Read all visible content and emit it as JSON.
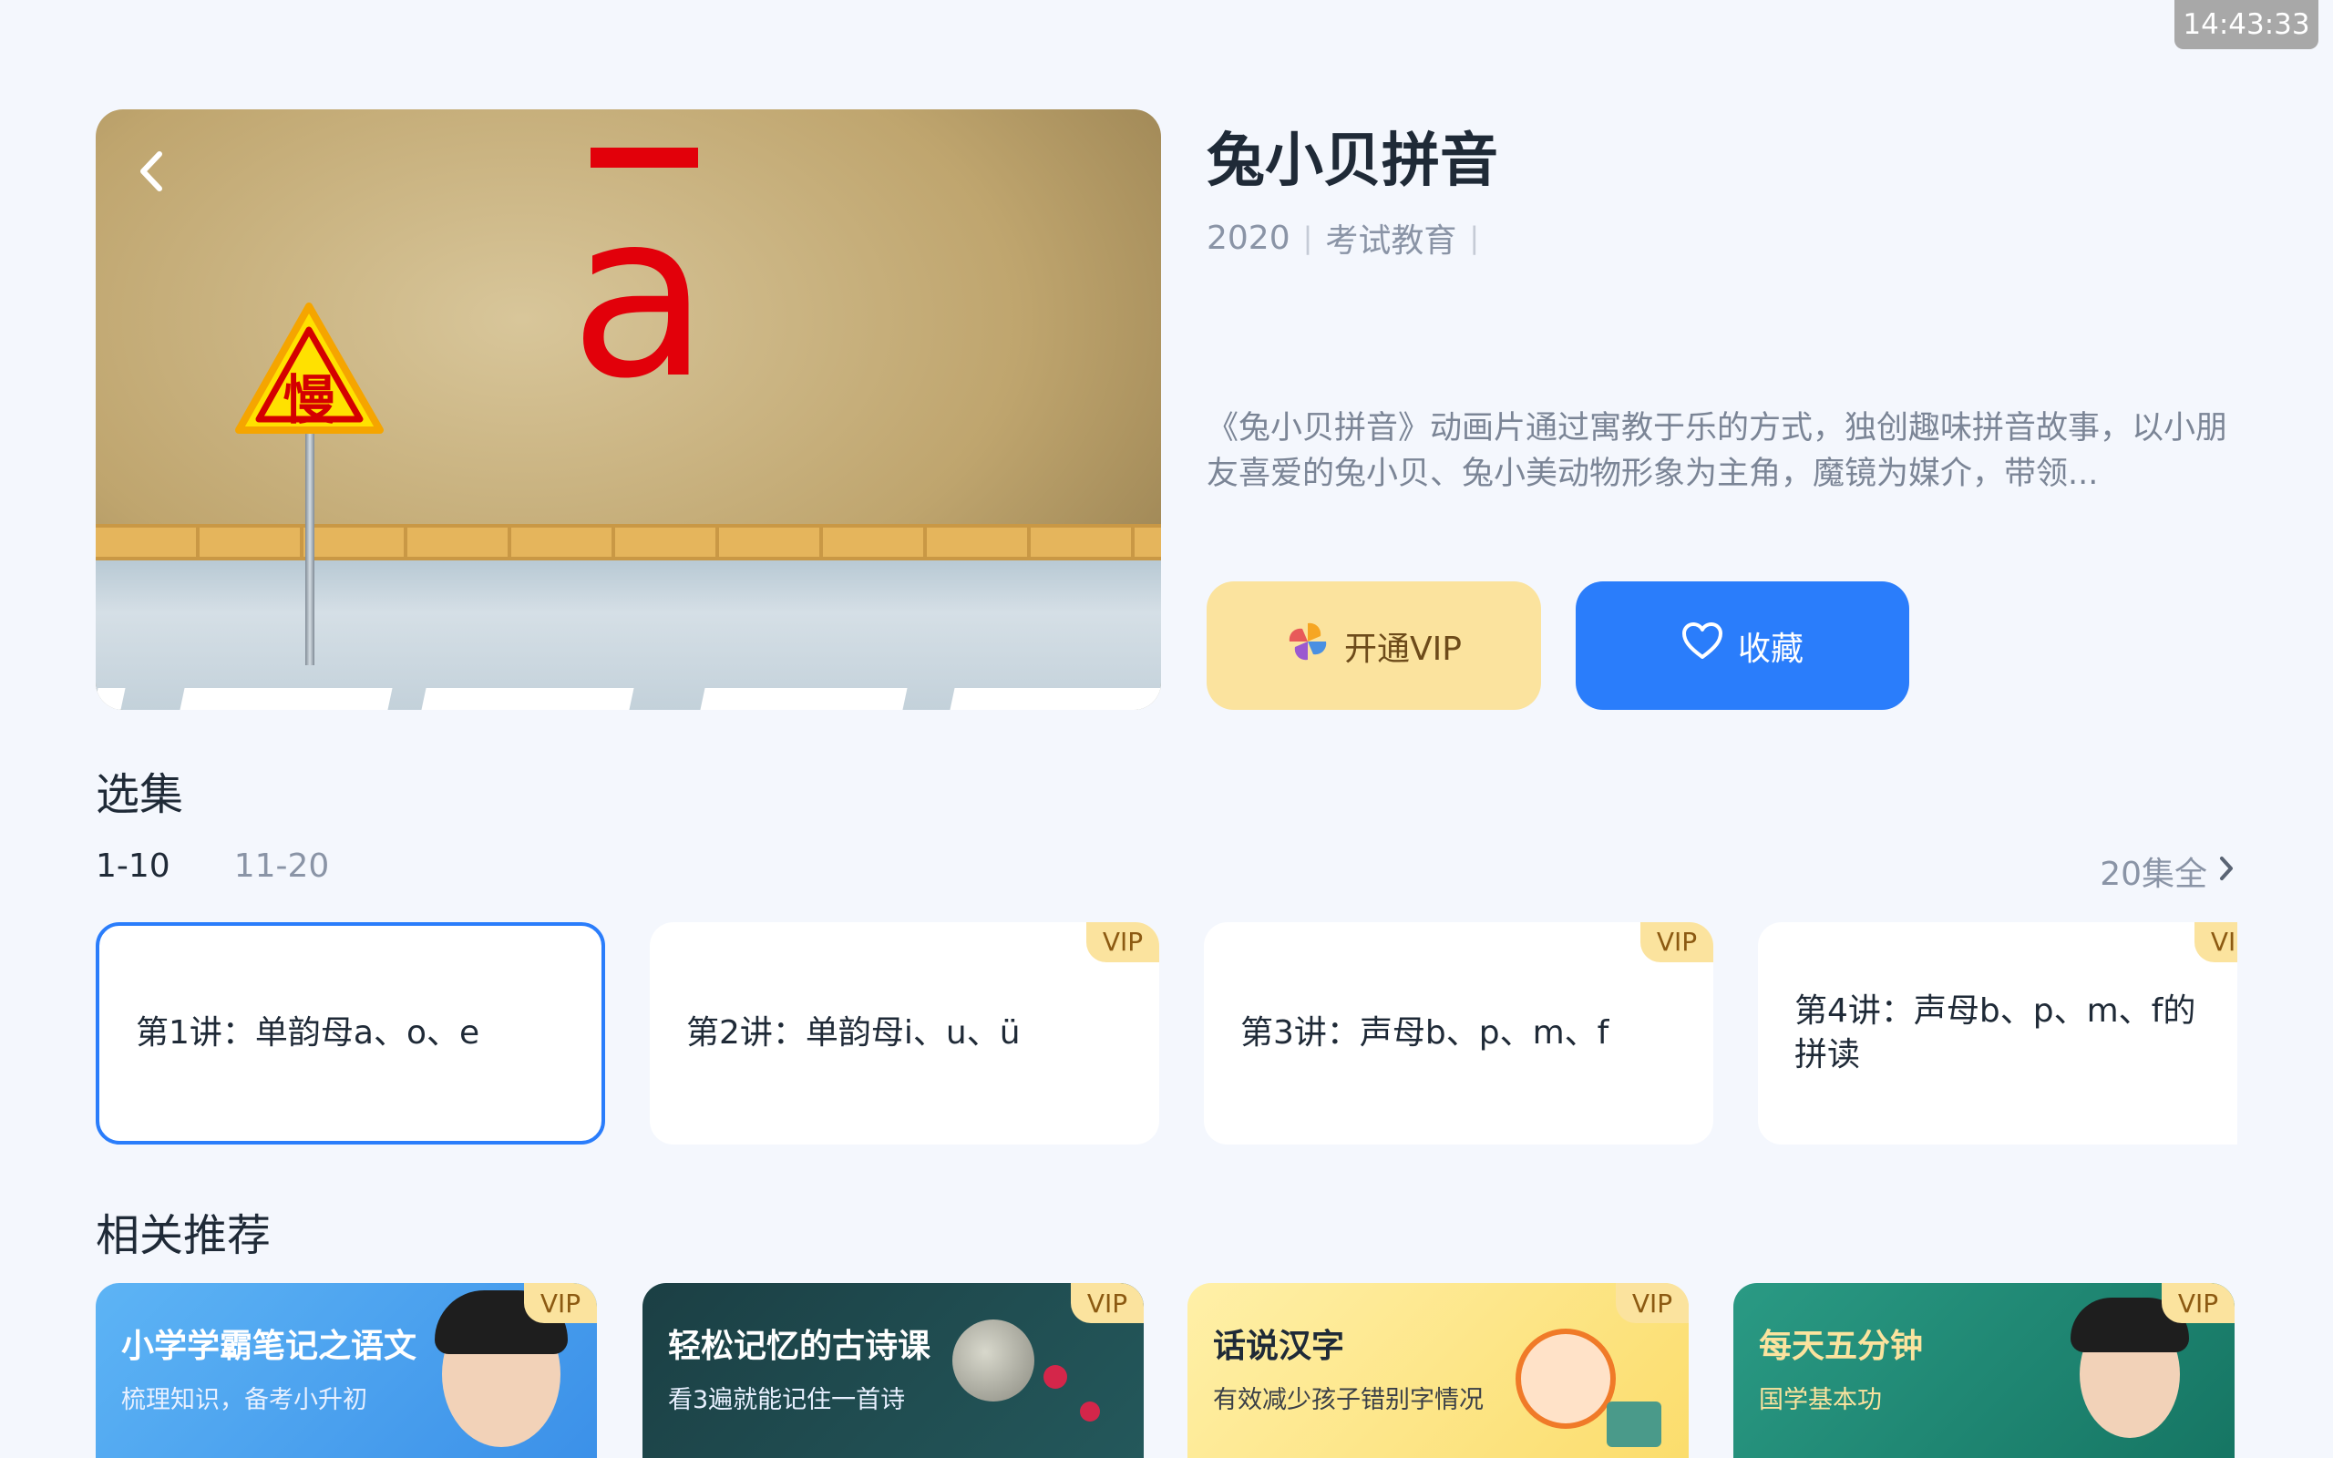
{
  "status_bar": {
    "time": "14:43:33"
  },
  "hero": {
    "sign_char": "慢",
    "pinyin_letter": "a"
  },
  "show": {
    "title": "兔小贝拼音",
    "year": "2020",
    "category": "考试教育",
    "description": "《兔小贝拼音》动画片通过寓教于乐的方式，独创趣味拼音故事，以小朋友喜爱的兔小贝、兔小美动物形象为主角，魔镜为媒介，带领..."
  },
  "actions": {
    "vip_label": "开通VIP",
    "favorite_label": "收藏"
  },
  "episodes_section": {
    "title": "选集",
    "tabs": [
      "1-10",
      "11-20"
    ],
    "total_label": "20集全",
    "items": [
      {
        "label": "第1讲：单韵母a、o、e",
        "vip": false,
        "selected": true
      },
      {
        "label": "第2讲：单韵母i、u、ü",
        "vip": true,
        "vip_label": "VIP"
      },
      {
        "label": "第3讲：声母b、p、m、f",
        "vip": true,
        "vip_label": "VIP"
      },
      {
        "label": "第4讲：声母b、p、m、f的拼读",
        "vip": true,
        "vip_label": "VIP"
      }
    ]
  },
  "recommend_section": {
    "title": "相关推荐",
    "items": [
      {
        "title": "小学学霸笔记之语文",
        "subtitle": "梳理知识，备考小升初",
        "vip_label": "VIP",
        "bg": "#4aa3f0"
      },
      {
        "title": "轻松记忆的古诗课",
        "subtitle": "看3遍就能记住一首诗",
        "vip_label": "VIP",
        "bg": "#1d4a4e"
      },
      {
        "title": "话说汉字",
        "subtitle": "有效减少孩子错别字情况",
        "vip_label": "VIP",
        "bg": "#fbe58c"
      },
      {
        "title": "每天五分钟",
        "subtitle": "国学基本功",
        "vip_label": "VIP",
        "bg": "#1f8a78"
      }
    ]
  },
  "colors": {
    "accent": "#2a7dfb",
    "vip_gold": "#fbe39e",
    "background": "#f4f7fd"
  },
  "icons": {
    "back": "chevron-left-icon",
    "vip": "pinwheel-icon",
    "favorite": "heart-outline-icon",
    "more": "chevron-right-icon"
  }
}
